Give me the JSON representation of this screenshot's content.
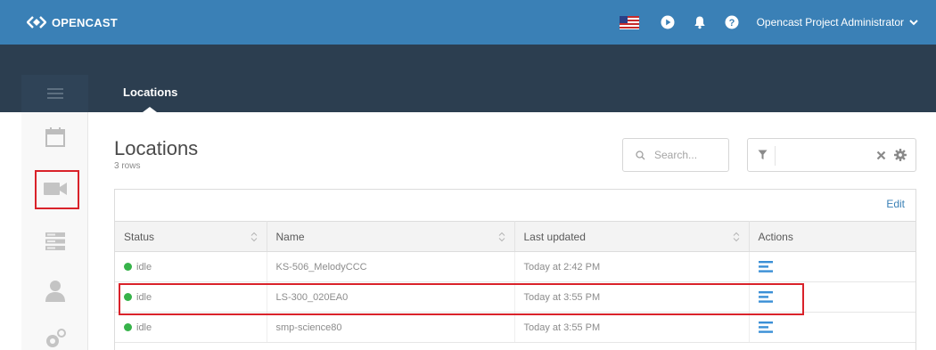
{
  "app": {
    "logo_text": "OPENCAST",
    "user_label": "Opencast Project Administrator"
  },
  "nav": {
    "tab_label": "Locations"
  },
  "sidebar": {
    "items": [
      {
        "icon": "menu-icon"
      },
      {
        "icon": "calendar-icon"
      },
      {
        "icon": "video-camera-icon",
        "active": true
      },
      {
        "icon": "server-icon"
      },
      {
        "icon": "user-icon"
      },
      {
        "icon": "gears-icon"
      }
    ]
  },
  "main": {
    "title": "Locations",
    "row_count": "3 rows",
    "search_placeholder": "Search...",
    "edit_label": "Edit"
  },
  "table": {
    "columns": [
      "Status",
      "Name",
      "Last updated",
      "Actions"
    ],
    "rows": [
      {
        "status": "idle",
        "name": "KS-506_MelodyCCC",
        "updated": "Today at 2:42 PM"
      },
      {
        "status": "idle",
        "name": "LS-300_020EA0",
        "updated": "Today at 3:55 PM"
      },
      {
        "status": "idle",
        "name": "smp-science80",
        "updated": "Today at 3:55 PM"
      }
    ]
  },
  "colors": {
    "topbar": "#3a80b6",
    "band": "#2c3e50",
    "status_idle": "#37b34a",
    "highlight": "#d9222a"
  }
}
